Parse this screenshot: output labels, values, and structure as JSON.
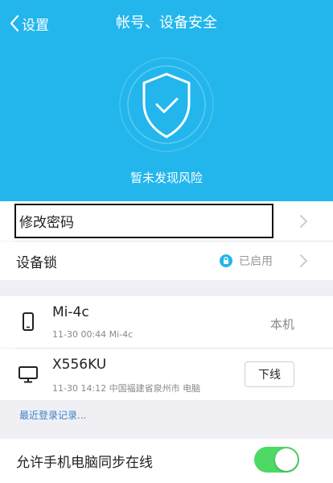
{
  "nav": {
    "back_label": "设置",
    "title": "帐号、设备安全"
  },
  "hero": {
    "status": "暂未发现风险"
  },
  "password": {
    "label": "修改密码"
  },
  "device_lock": {
    "label": "设备锁",
    "status": "已启用"
  },
  "devices": [
    {
      "name": "Mi-4c",
      "meta": "11-30 00:44 Mi-4c",
      "tag": "本机",
      "icon": "phone-icon"
    },
    {
      "name": "X556KU",
      "meta": "11-30 14:12 中国福建省泉州市 电脑",
      "action": "下线",
      "icon": "monitor-icon"
    }
  ],
  "recent_login_link": "最近登录记录...",
  "sync": {
    "label": "允许手机电脑同步在线",
    "enabled": true
  },
  "colors": {
    "header_bg": "#22b6ec",
    "toggle_on": "#4cd964",
    "link": "#3a83c8",
    "lock_icon": "#22b6ec"
  }
}
